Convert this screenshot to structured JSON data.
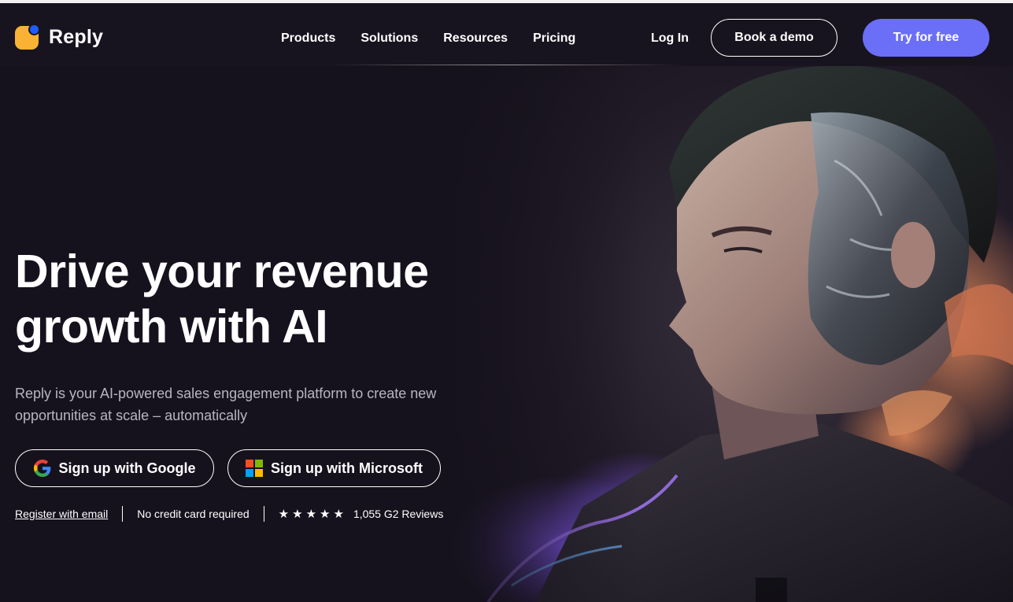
{
  "brand": {
    "name": "Reply",
    "logo_icon": "reply-logo-icon"
  },
  "nav": {
    "items": [
      {
        "label": "Products"
      },
      {
        "label": "Solutions"
      },
      {
        "label": "Resources"
      },
      {
        "label": "Pricing"
      }
    ]
  },
  "header_actions": {
    "login_label": "Log In",
    "demo_label": "Book a demo",
    "try_label": "Try for free"
  },
  "hero": {
    "headline_line1": "Drive your revenue",
    "headline_line2": "growth with AI",
    "subtext_line1": "Reply is your AI-powered sales engagement platform to create new",
    "subtext_line2": "opportunities at scale – automatically",
    "google_button_label": "Sign up with Google",
    "microsoft_button_label": "Sign up with Microsoft",
    "register_link": "Register with email",
    "no_card": "No credit card required",
    "rating_stars": 5,
    "reviews": "1,055 G2 Reviews"
  },
  "colors": {
    "background": "#16121d",
    "accent": "#6b6ef6",
    "logo_yellow": "#f9b233",
    "logo_blue": "#1e5cff"
  }
}
